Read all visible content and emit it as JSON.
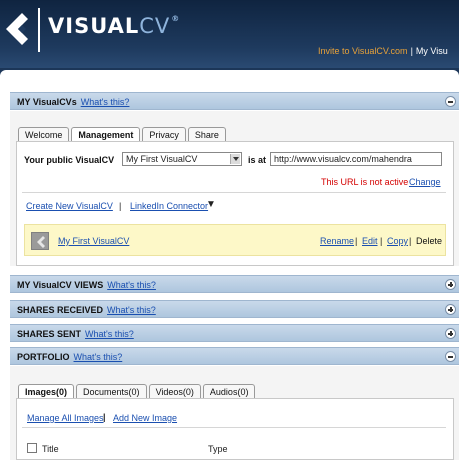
{
  "header": {
    "brand_main": "VISUAL",
    "brand_cv": "CV",
    "brand_reg": "®",
    "invite_link": "Invite to VisualCV.com",
    "separator": "|",
    "my_visualcv_link": "My Visu"
  },
  "my_visualcvs": {
    "title": "MY VisualCVs",
    "help": "What's this?",
    "tabs": [
      "Welcome",
      "Management",
      "Privacy",
      "Share"
    ],
    "active_tab": "Management",
    "public_label": "Your public VisualCV",
    "public_select": "My First VisualCV",
    "is_at_label": "is at",
    "url_value": "http://www.visualcv.com/mahendra",
    "url_status": "This URL is not active",
    "change_link": "Change",
    "create_link": "Create New VisualCV",
    "links_separator": "|",
    "linkedin_link": "LinkedIn Connector",
    "linkedin_arrow": "▼",
    "cv_item": {
      "name": "My First VisualCV",
      "rename": "Rename",
      "edit": "Edit",
      "copy": "Copy",
      "delete": "Delete",
      "sep": "|"
    }
  },
  "sections": [
    {
      "title": "MY VisualCV VIEWS",
      "help": "What's this?"
    },
    {
      "title": "SHARES RECEIVED",
      "help": "What's this?"
    },
    {
      "title": "SHARES SENT",
      "help": "What's this?"
    }
  ],
  "portfolio": {
    "title": "PORTFOLIO",
    "help": "What's this?",
    "tabs": [
      "Images(0)",
      "Documents(0)",
      "Videos(0)",
      "Audios(0)"
    ],
    "active_tab": "Images(0)",
    "manage_link": "Manage All Images",
    "separator": "|",
    "add_link": "Add New Image",
    "columns": [
      "Title",
      "Type"
    ]
  },
  "colors": {
    "header_bg": "#1c3658",
    "invite": "#e8a23a",
    "section_bar": "#b8cde3",
    "highlight_row": "#fdf8c8",
    "error_text": "#d40000",
    "link": "#1a4fb0"
  }
}
